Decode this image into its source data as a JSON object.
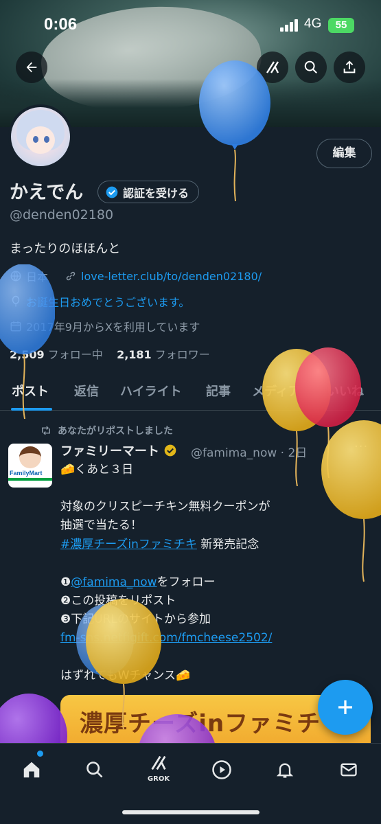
{
  "status_bar": {
    "time": "0:06",
    "network": "4G",
    "battery": "55"
  },
  "header": {
    "back_icon": "back-arrow-icon",
    "grok_icon": "grok-icon",
    "search_icon": "search-icon",
    "share_icon": "share-icon"
  },
  "profile": {
    "edit_label": "編集",
    "name": "かえでん",
    "verify_label": "認証を受ける",
    "handle": "@denden02180",
    "bio": "まったりのほほんと",
    "location": "日本",
    "link": "love-letter.club/to/denden02180/",
    "birthday": "お誕生日おめでとうございます。",
    "joined": "2017年9月からXを利用しています",
    "following_count": "2,509",
    "following_label": "フォロー中",
    "followers_count": "2,181",
    "followers_label": "フォロワー"
  },
  "tabs": [
    {
      "label": "ポスト"
    },
    {
      "label": "返信"
    },
    {
      "label": "ハイライト"
    },
    {
      "label": "記事"
    },
    {
      "label": "メディア"
    },
    {
      "label": "いいね"
    }
  ],
  "post": {
    "repost_label": "あなたがリポストしました",
    "author_name": "ファミリーマート",
    "author_handle": "@famima_now · 2日",
    "avatar_text": "FamilyMart",
    "line1": "🧀くあと３日",
    "line2": "対象のクリスピーチキン無料クーポンが",
    "line3": "抽選で当たる！",
    "hashtag": "#濃厚チーズinファミチキ",
    "hashtag_suffix": " 新発売記念",
    "step1_prefix": "❶",
    "step1_mention": "@famima_now",
    "step1_suffix": "をフォロー",
    "step2": "❷この投稿をリポスト",
    "step3": "❸下記URLのサイトから参加",
    "url": "fm-sns.netfigift.com/fmcheese2502/",
    "closing": "はずれてもWチャンス🧀",
    "promo_text": "濃厚チーズinファミチ"
  },
  "bottom_nav": {
    "items": [
      "home-icon",
      "search-icon",
      "grok-icon",
      "video-icon",
      "notifications-icon",
      "messages-icon"
    ],
    "grok_label": "GROK"
  },
  "colors": {
    "accent": "#1d9bf0",
    "background": "#15202b",
    "muted": "#8b98a5"
  }
}
